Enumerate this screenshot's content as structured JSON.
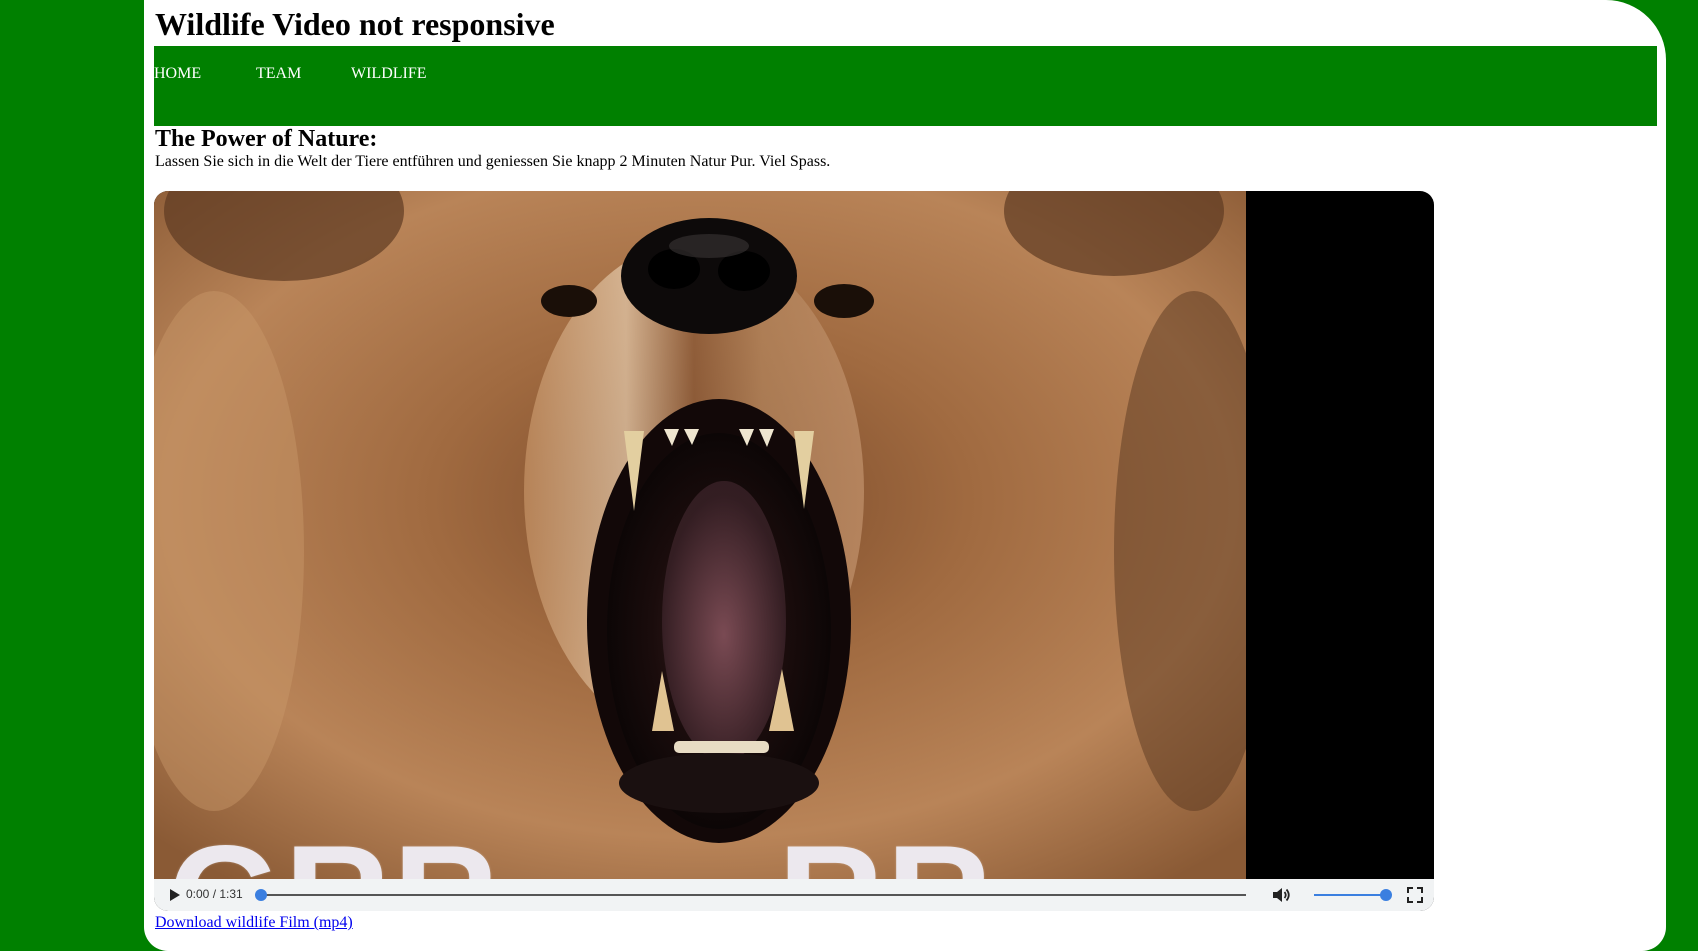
{
  "header": {
    "title": "Wildlife Video not responsive"
  },
  "nav": {
    "items": [
      {
        "label": "HOME"
      },
      {
        "label": "TEAM"
      },
      {
        "label": "WILDLIFE"
      }
    ]
  },
  "main": {
    "heading": "The Power of Nature:",
    "intro": "Lassen Sie sich in die Welt der Tiere entführen und geniessen Sie knapp 2 Minuten Natur Pur. Viel Spass."
  },
  "video": {
    "overlay_left": "GRR",
    "overlay_right": "RR",
    "time_display": "0:00 / 1:31",
    "progress_fraction": 0,
    "volume_fraction": 1,
    "icons": {
      "play": "play-icon",
      "mute": "volume-icon",
      "fullscreen": "fullscreen-icon"
    }
  },
  "download": {
    "link_text": "Download wildlife Film (mp4)"
  },
  "colors": {
    "page_background": "#008000",
    "navbar": "#008000",
    "content_background": "#ffffff",
    "accent_blue": "#3b7fe0",
    "link": "#0000ee"
  }
}
